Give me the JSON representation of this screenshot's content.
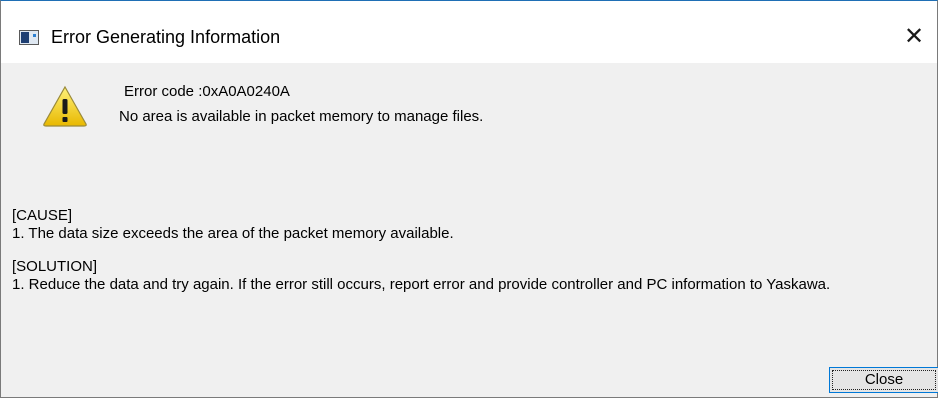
{
  "window": {
    "title": "Error Generating Information",
    "close_glyph": "✕"
  },
  "icons": {
    "title_icon": "app-window-icon",
    "warning_icon": "warning-icon",
    "close_icon": "close-icon"
  },
  "error": {
    "code_line": "Error code :0xA0A0240A",
    "message": "No area is available in packet memory to manage files."
  },
  "cause": {
    "heading": "[CAUSE]",
    "items": [
      "1. The data size exceeds the area of the packet memory available."
    ]
  },
  "solution": {
    "heading": "[SOLUTION]",
    "items": [
      "1. Reduce the data and try again. If the error still occurs, report error and provide controller and PC information to Yaskawa."
    ]
  },
  "buttons": {
    "close_label": "Close"
  },
  "colors": {
    "dialog_bg": "#f0f0f0",
    "title_bg": "#ffffff",
    "warning_yellow": "#f5d400",
    "button_border": "#0078d7"
  }
}
